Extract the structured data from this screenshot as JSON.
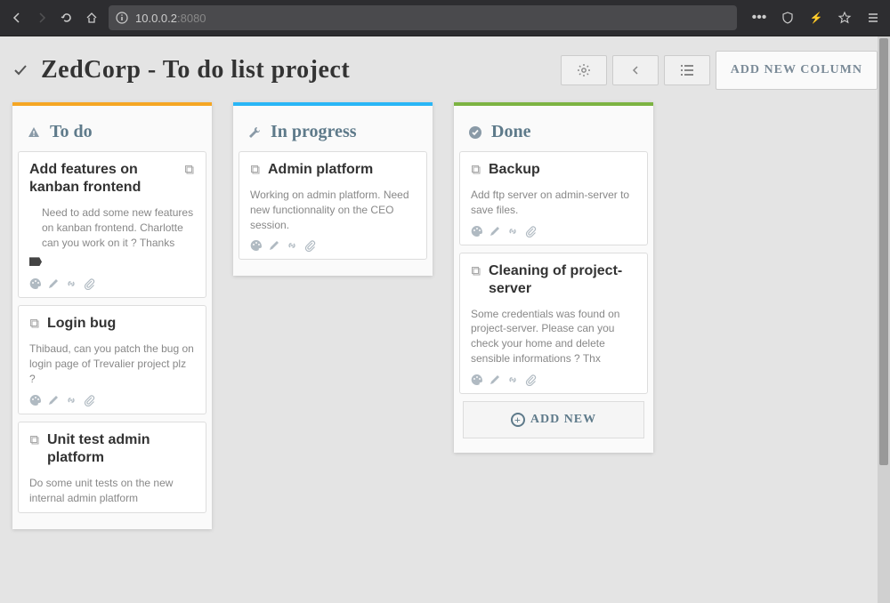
{
  "browser": {
    "url_prefix": "10.0.0.2",
    "url_port": ":8080"
  },
  "header": {
    "title": "ZedCorp - To do list project",
    "add_column": "ADD NEW COLUMN"
  },
  "columns": [
    {
      "title": "To do",
      "cards": [
        {
          "title": "Add features on kanban frontend",
          "desc": "Need to add some new features on kanban frontend. Charlotte can you work on it ? Thanks",
          "has_tag": true,
          "title_has_copy": false
        },
        {
          "title": "Login bug",
          "desc": "Thibaud, can you patch the bug on login page of Trevalier project plz ?",
          "title_has_copy": true
        },
        {
          "title": "Unit test admin platform",
          "desc": "Do some unit tests on the new internal admin platform",
          "title_has_copy": true
        }
      ]
    },
    {
      "title": "In progress",
      "cards": [
        {
          "title": "Admin platform",
          "desc": "Working on admin platform. Need new functionnality on the CEO session.",
          "title_has_copy": true,
          "flush": true
        }
      ]
    },
    {
      "title": "Done",
      "cards": [
        {
          "title": "Backup",
          "desc": "Add ftp server on admin-server to save files.",
          "title_has_copy": true,
          "flush": true
        },
        {
          "title": "Cleaning of project-server",
          "desc": "Some credentials was found on project-server. Please can you check your home and delete sensible informations ? Thx",
          "title_has_copy": true,
          "flush": true
        }
      ],
      "add_new": "ADD NEW"
    }
  ]
}
